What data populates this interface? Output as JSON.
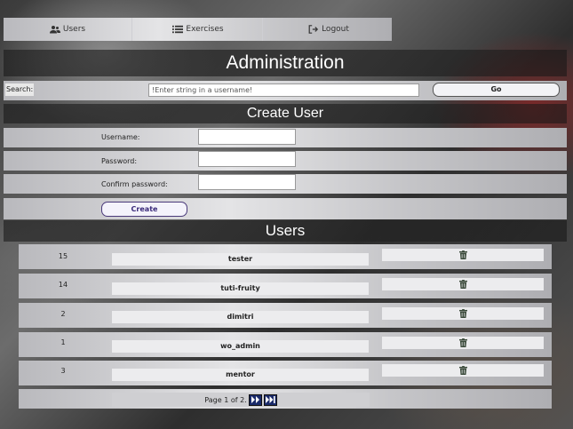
{
  "nav": {
    "items": [
      {
        "label": "Users",
        "icon": "users-icon"
      },
      {
        "label": "Exercises",
        "icon": "list-icon"
      },
      {
        "label": "Logout",
        "icon": "logout-icon"
      }
    ]
  },
  "header": {
    "title": "Administration"
  },
  "search": {
    "label": "Search:",
    "placeholder": "!Enter string in a username!",
    "go_label": "Go"
  },
  "create_user": {
    "title": "Create User",
    "username_label": "Username:",
    "password_label": "Password:",
    "confirm_label": "Confirm password:",
    "create_label": "Create"
  },
  "users": {
    "title": "Users",
    "rows": [
      {
        "id": "15",
        "name": "tester"
      },
      {
        "id": "14",
        "name": "tuti-fruity"
      },
      {
        "id": "2",
        "name": "dimitri"
      },
      {
        "id": "1",
        "name": "wo_admin"
      },
      {
        "id": "3",
        "name": "mentor"
      }
    ],
    "delete_icon": "trash-icon"
  },
  "pagination": {
    "text": "Page 1 of 2.",
    "next_icon": "next-page-icon",
    "last_icon": "last-page-icon"
  }
}
